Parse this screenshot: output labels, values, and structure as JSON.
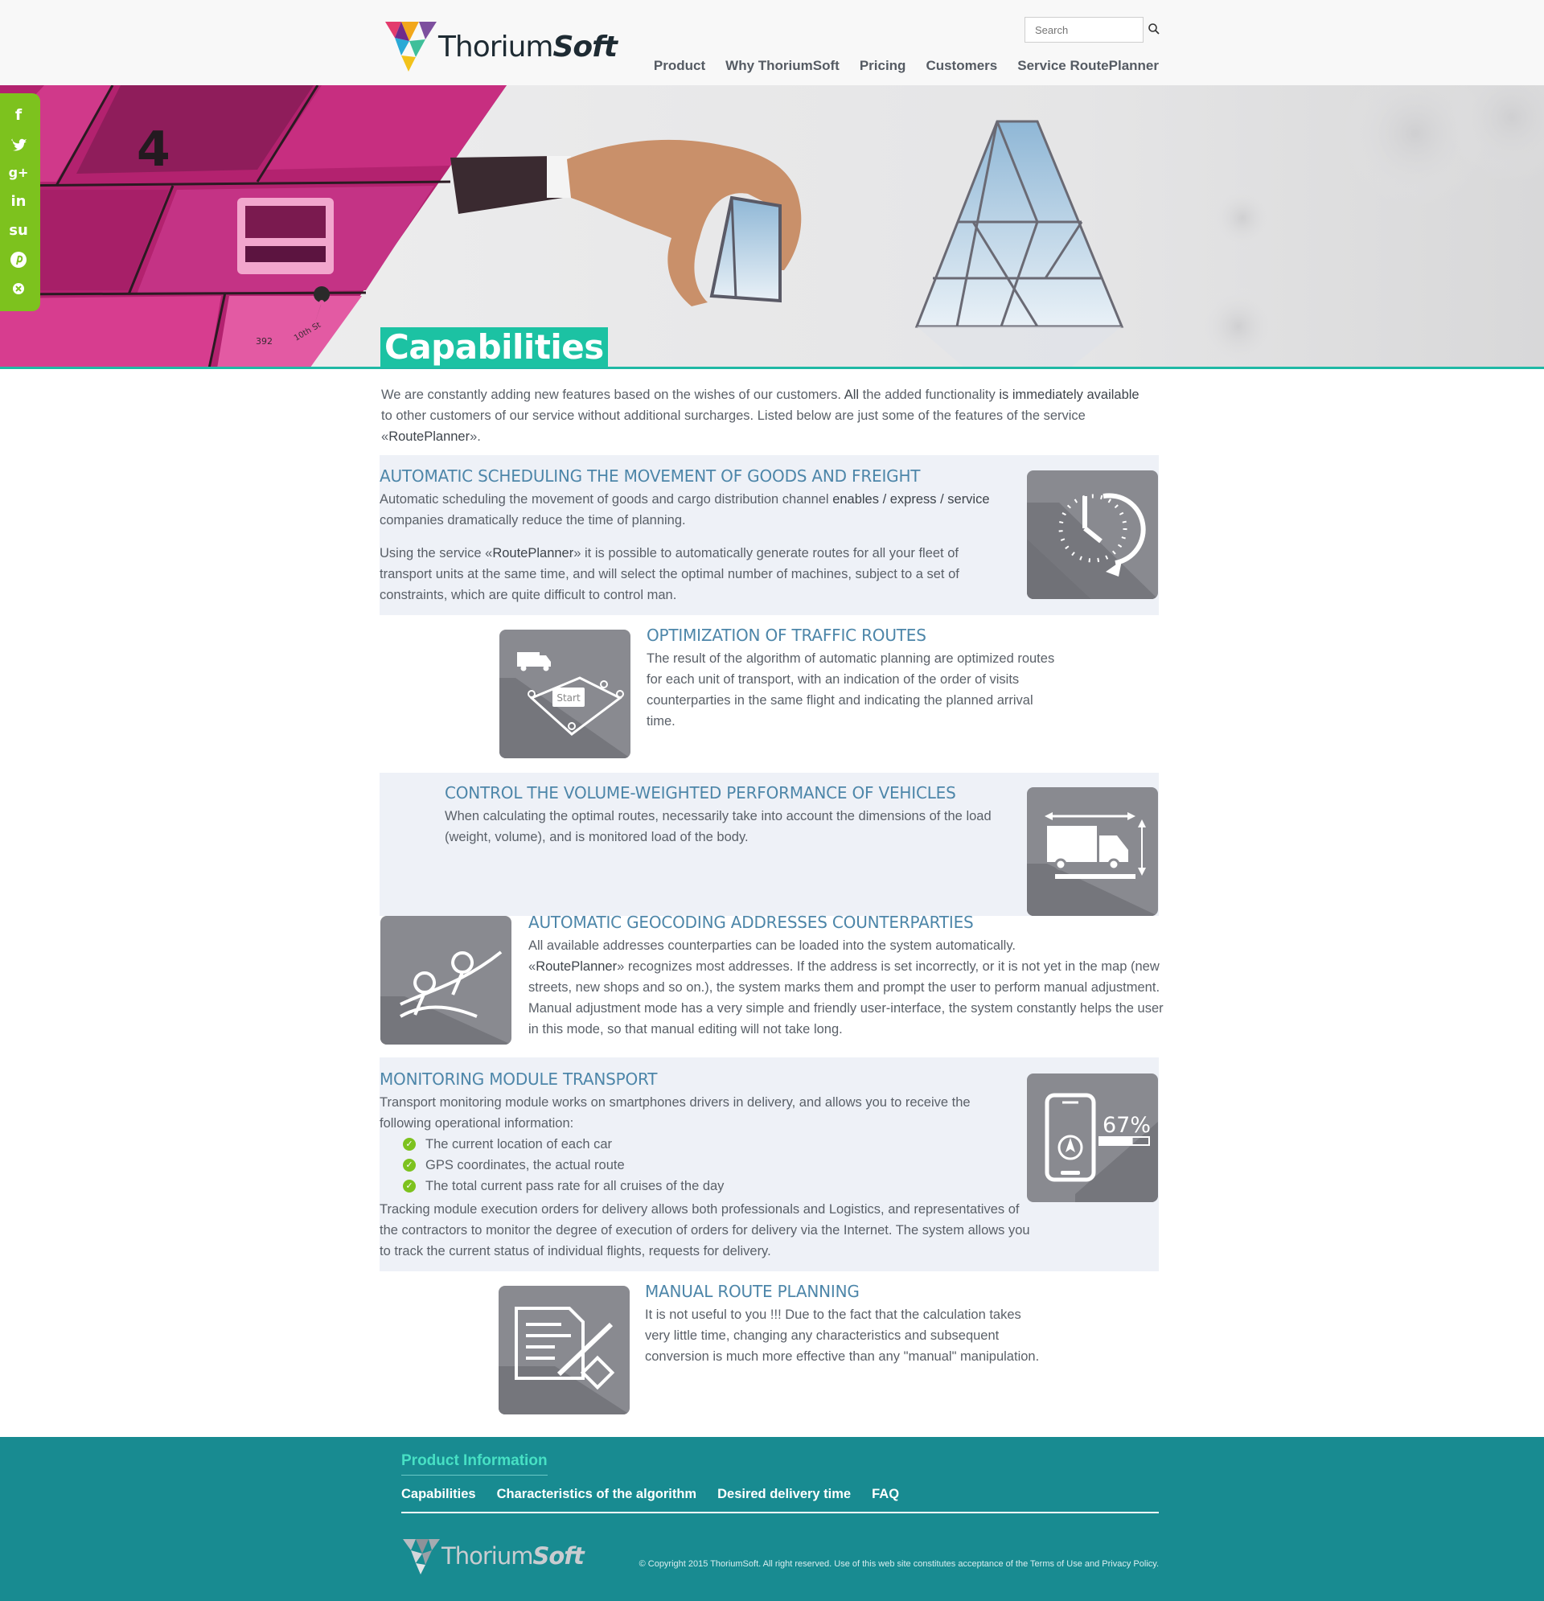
{
  "header": {
    "logo_text_a": "Thorium",
    "logo_text_b": "Soft",
    "search_placeholder": "Search",
    "nav": [
      "Product",
      "Why ThoriumSoft",
      "Pricing",
      "Customers",
      "Service RoutePlanner"
    ]
  },
  "hero": {
    "title": "Capabilities",
    "map_labels": [
      "392",
      "10th St"
    ]
  },
  "social": [
    "facebook-icon",
    "twitter-icon",
    "google-plus-icon",
    "linkedin-icon",
    "stumbleupon-icon",
    "pinterest-icon",
    "more-icon"
  ],
  "intro": {
    "p1": "We are constantly adding new features based on the wishes of our customers.",
    "p2": "All",
    "p3": "the added functionality",
    "p4": "is immediately available",
    "p5": "to other customers of our service without additional surcharges. Listed below are just some of the features of the service «",
    "p6": "RoutePlanner",
    "p7": "»."
  },
  "features": [
    {
      "title": "AUTOMATIC SCHEDULING THE MOVEMENT OF GOODS AND FREIGHT",
      "text1a": "Automatic scheduling the movement of goods and cargo distribution channel",
      "text1b": "enables / express / service",
      "text1c": "companies dramatically reduce the time of planning.",
      "text2a": "Using the service «",
      "text2b": "RoutePlanner",
      "text2c": "» it is possible to automatically generate routes for all your fleet of transport units at the same time, and will select the optimal number of machines, subject to a set of constraints, which are quite difficult to control man."
    },
    {
      "title": "OPTIMIZATION OF TRAFFIC ROUTES",
      "text": "The result of the algorithm of automatic planning are optimized routes for each unit of transport, with an indication of the order of visits counterparties in the same flight and indicating the planned arrival time.",
      "tile_label": "Start"
    },
    {
      "title": "CONTROL THE VOLUME-WEIGHTED PERFORMANCE OF VEHICLES",
      "text": "When calculating the optimal routes, necessarily take into account the dimensions of the load (weight, volume), and is monitored load of the body."
    },
    {
      "title": "AUTOMATIC GEOCODING ADDRESSES COUNTERPARTIES",
      "text1": "All available addresses counterparties can be loaded into the system automatically.",
      "text2a": "«",
      "text2b": "RoutePlanner",
      "text2c": "» recognizes most addresses. If the address is set incorrectly, or it is not yet in the map (new streets, new shops and so on.), the system marks them and prompt the user to perform manual adjustment. Manual adjustment mode has a very simple and friendly user-interface, the system constantly helps the user in this mode, so that manual editing will not take long."
    },
    {
      "title": "MONITORING MODULE TRANSPORT",
      "text1": "Transport monitoring module works on smartphones drivers in delivery, and allows you to receive the following operational information:",
      "items": [
        "The current location of each car",
        "GPS coordinates, the actual route",
        "The total current pass rate for all cruises of the day"
      ],
      "text2": "Tracking module execution orders for delivery allows both professionals and Logistics, and representatives of the contractors to monitor the degree of execution of orders for delivery via the Internet. The system allows you to track the current status of individual flights, requests for delivery.",
      "tile_label": "67%",
      "tile_progress": 0.67
    },
    {
      "title": "MANUAL ROUTE PLANNING",
      "text": "It is not useful to you !!! Due to the fact that the calculation takes very little time, changing any characteristics and subsequent conversion is much more effective than any \"manual\" manipulation."
    }
  ],
  "footer": {
    "title": "Product Information",
    "links": [
      "Capabilities",
      "Characteristics of the algorithm",
      "Desired delivery time",
      "FAQ"
    ],
    "logo_text_a": "Thorium",
    "logo_text_b": "Soft",
    "copyright": "© Copyright 2015 ThoriumSoft. All right reserved. Use of this web site constitutes acceptance of the Terms of Use and Privacy Policy."
  },
  "colors": {
    "accent": "#1cc2a3",
    "heading": "#4d86a9",
    "social": "#7dc21e",
    "footer": "#188b91",
    "tile": "#898a90",
    "hero_magenta": "#c3267a"
  }
}
